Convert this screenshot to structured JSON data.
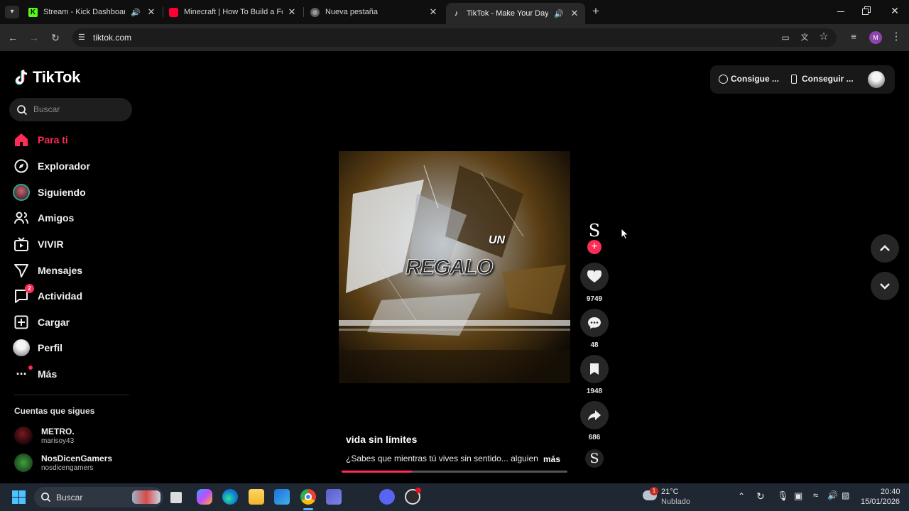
{
  "browser": {
    "tabs": [
      {
        "title": "Stream - Kick Dashboard",
        "icon": "kick-icon",
        "audio": true
      },
      {
        "title": "Minecraft | How To Build a Fore",
        "icon": "youtube-icon",
        "audio": false
      },
      {
        "title": "Nueva pestaña",
        "icon": "chrome-icon",
        "audio": false
      },
      {
        "title": "TikTok - Make Your Day",
        "icon": "tiktok-icon",
        "audio": true,
        "active": true
      }
    ],
    "url": "tiktok.com",
    "profile_initial": "M"
  },
  "sidebar": {
    "logo": "TikTok",
    "search_placeholder": "Buscar",
    "nav": [
      {
        "label": "Para ti",
        "icon": "home-icon",
        "active": true
      },
      {
        "label": "Explorador",
        "icon": "compass-icon"
      },
      {
        "label": "Siguiendo",
        "icon": "following-avatar-icon"
      },
      {
        "label": "Amigos",
        "icon": "friends-icon"
      },
      {
        "label": "VIVIR",
        "icon": "live-tv-icon"
      },
      {
        "label": "Mensajes",
        "icon": "send-icon"
      },
      {
        "label": "Actividad",
        "icon": "activity-icon",
        "badge": "2"
      },
      {
        "label": "Cargar",
        "icon": "upload-icon"
      },
      {
        "label": "Perfil",
        "icon": "profile-avatar-icon"
      },
      {
        "label": "Más",
        "icon": "more-dots-icon"
      }
    ],
    "following_title": "Cuentas que sigues",
    "accounts": [
      {
        "name": "METRO.",
        "handle": "marisoy43"
      },
      {
        "name": "NosDicenGamers",
        "handle": "nosdicengamers"
      }
    ]
  },
  "header": {
    "coins_button": "Consigue ...",
    "app_button": "Conseguir ..."
  },
  "video": {
    "overlay_small": "UN",
    "overlay_big": "REGALO",
    "title": "vida sin límites",
    "description": "¿Sabes que mientras tú vives sin sentido... alguien",
    "more": "más",
    "progress": 0.31,
    "likes": "9749",
    "comments": "48",
    "saves": "1948",
    "shares": "686",
    "creator_initial": "S"
  },
  "taskbar": {
    "search_placeholder": "Buscar",
    "weather_temp": "21°C",
    "weather_desc": "Nublado",
    "weather_badge": "1",
    "time": "20:40",
    "date": "15/01/2026"
  },
  "colors": {
    "accent": "#fe2c55",
    "background": "#000000",
    "chrome_bar": "#282828"
  }
}
